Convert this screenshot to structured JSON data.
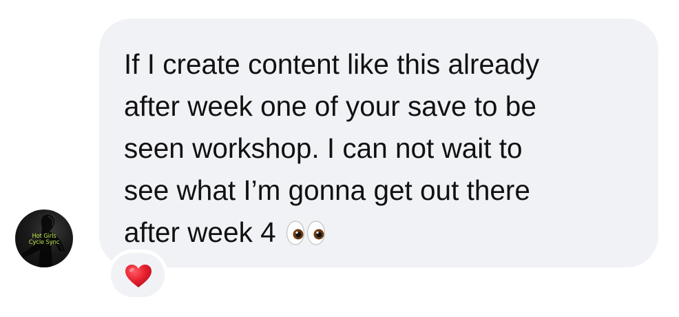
{
  "sender": {
    "avatar_name": "Hot Girls Cycle Sync",
    "avatar_line1": "Hot Girls",
    "avatar_line2": "Cycle Sync"
  },
  "message": {
    "lines": [
      "If I create content like this already",
      "after week one of your save to be",
      "seen workshop. I can not wait to",
      "see what I’m gonna get out there",
      "after week 4"
    ],
    "emoji_icon": "eyes-emoji-icon"
  },
  "reaction": {
    "icon": "red-heart-icon"
  },
  "colors": {
    "bubble_bg": "#f1f2f6",
    "text": "#111111",
    "heart": "#e8202f",
    "avatar_text": "#b8e04a"
  }
}
